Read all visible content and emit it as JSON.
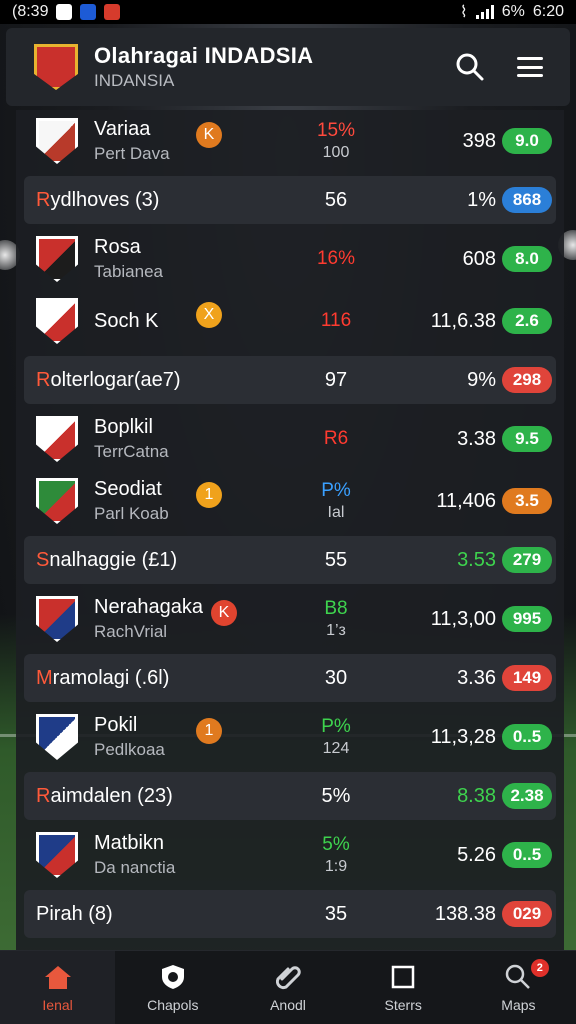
{
  "status_bar": {
    "time": "(8:39",
    "battery": "6%",
    "clock": "6:20"
  },
  "header": {
    "title": "Olahragai INDADSIA",
    "subtitle": "INDANSIA"
  },
  "colors": {
    "green": "#2eb34a",
    "blue": "#2b7fd8",
    "red": "#e0443a",
    "orange": "#e07a1f",
    "accent": "#e8583d"
  },
  "rows": [
    {
      "kind": "team",
      "name": "Variaa",
      "sub": "Pert Dava",
      "badge": "K",
      "badge_color": "orange",
      "pct": "15%",
      "pct_color": "#ff4a3d",
      "pct_sub": "100",
      "value": "398",
      "pill": "9.0",
      "pill_color": "#2eb34a",
      "crest_a": "#f7f7f7",
      "crest_b": "#b83a2a"
    },
    {
      "kind": "group",
      "name_first": "R",
      "name_rest": "ydlhoves (3)",
      "mid": "56",
      "value": "1%",
      "value_color": "#ffffff",
      "pill": "868",
      "pill_color": "#2b7fd8"
    },
    {
      "kind": "team",
      "name": "Rosa",
      "sub": "Tabianea",
      "badge": "",
      "badge_color": "",
      "pct": "16%",
      "pct_color": "#ff3b30",
      "pct_sub": "",
      "value": "608",
      "pill": "8.0",
      "pill_color": "#2eb34a",
      "crest_a": "#c9302c",
      "crest_b": "#1c1c1c"
    },
    {
      "kind": "team",
      "name": "Soch K",
      "sub": "",
      "badge": "X",
      "badge_color": "yellow",
      "pct": "116",
      "pct_color": "#ff3b30",
      "pct_sub": "",
      "value": "11,6.38",
      "pill": "2.6",
      "pill_color": "#2eb34a",
      "crest_a": "#ffffff",
      "crest_b": "#c9302c"
    },
    {
      "kind": "group",
      "name_first": "R",
      "name_rest": "olterlogar(ae7)",
      "mid": "97",
      "value": "9%",
      "value_color": "#ffffff",
      "pill": "298",
      "pill_color": "#e0443a"
    },
    {
      "kind": "team",
      "name": "Boplkil",
      "sub": "TerrCatna",
      "badge": "",
      "badge_color": "",
      "pct": "R6",
      "pct_color": "#ff3b30",
      "pct_sub": "",
      "value": "3.38",
      "pill": "9.5",
      "pill_color": "#2eb34a",
      "crest_a": "#ffffff",
      "crest_b": "#c9302c"
    },
    {
      "kind": "team",
      "name": "Seodiat",
      "sub": "Parl Koab",
      "badge": "1",
      "badge_color": "yellow",
      "pct": "P%",
      "pct_color": "#3aa0ff",
      "pct_sub": "Ial",
      "value": "11,406",
      "pill": "3.5",
      "pill_color": "#e07a1f",
      "crest_a": "#2e8b3a",
      "crest_b": "#c9302c"
    },
    {
      "kind": "group",
      "name_first": "S",
      "name_rest": "nalhaggie (£1)",
      "mid": "55",
      "value": "3.53",
      "value_color": "#3ed34e",
      "pill": "279",
      "pill_color": "#2eb34a"
    },
    {
      "kind": "team",
      "name": "Nerahagaka",
      "sub": "RachVrial",
      "badge": "K",
      "badge_color": "red",
      "pct": "B8",
      "pct_color": "#3ed34e",
      "pct_sub": "1’з",
      "value": "11,3,00",
      "pill": "995",
      "pill_color": "#2eb34a",
      "crest_a": "#c9302c",
      "crest_b": "#1f3c88"
    },
    {
      "kind": "group",
      "name_first": "M",
      "name_rest": "ramolagi (.6l)",
      "mid": "30",
      "value": "3.36",
      "value_color": "#ffffff",
      "pill": "149",
      "pill_color": "#e0443a"
    },
    {
      "kind": "team",
      "name": "Pokil",
      "sub": "Pedlkoaa",
      "badge": "1",
      "badge_color": "orange",
      "pct": "P%",
      "pct_color": "#3ed34e",
      "pct_sub": "124",
      "value": "11,3,28",
      "pill": "0..5",
      "pill_color": "#2eb34a",
      "crest_a": "#1f3c88",
      "crest_b": "#ffffff"
    },
    {
      "kind": "group",
      "name_first": "R",
      "name_rest": "aimdalen (23)",
      "mid": "5%",
      "value": "8.38",
      "value_color": "#3ed34e",
      "pill": "2.38",
      "pill_color": "#2eb34a"
    },
    {
      "kind": "team",
      "name": "Matbikn",
      "sub": "Da nanctia",
      "badge": "",
      "badge_color": "",
      "pct": "5%",
      "pct_color": "#3ed34e",
      "pct_sub": "1:9",
      "value": "5.26",
      "pill": "0..5",
      "pill_color": "#2eb34a",
      "crest_a": "#1f3c88",
      "crest_b": "#c9302c"
    },
    {
      "kind": "group",
      "name_first": "",
      "name_rest": "Pirah (8)",
      "mid": "35",
      "value": "138.38",
      "value_color": "#ffffff",
      "pill": "029",
      "pill_color": "#e0443a"
    }
  ],
  "nav": [
    {
      "label": "Ienal",
      "icon": "home-icon",
      "active": true
    },
    {
      "label": "Chapols",
      "icon": "shield-icon",
      "active": false
    },
    {
      "label": "Anodl",
      "icon": "clip-icon",
      "active": false
    },
    {
      "label": "Sterrs",
      "icon": "square-icon",
      "active": false
    },
    {
      "label": "Maps",
      "icon": "search-icon",
      "active": false,
      "notification": "2"
    }
  ]
}
